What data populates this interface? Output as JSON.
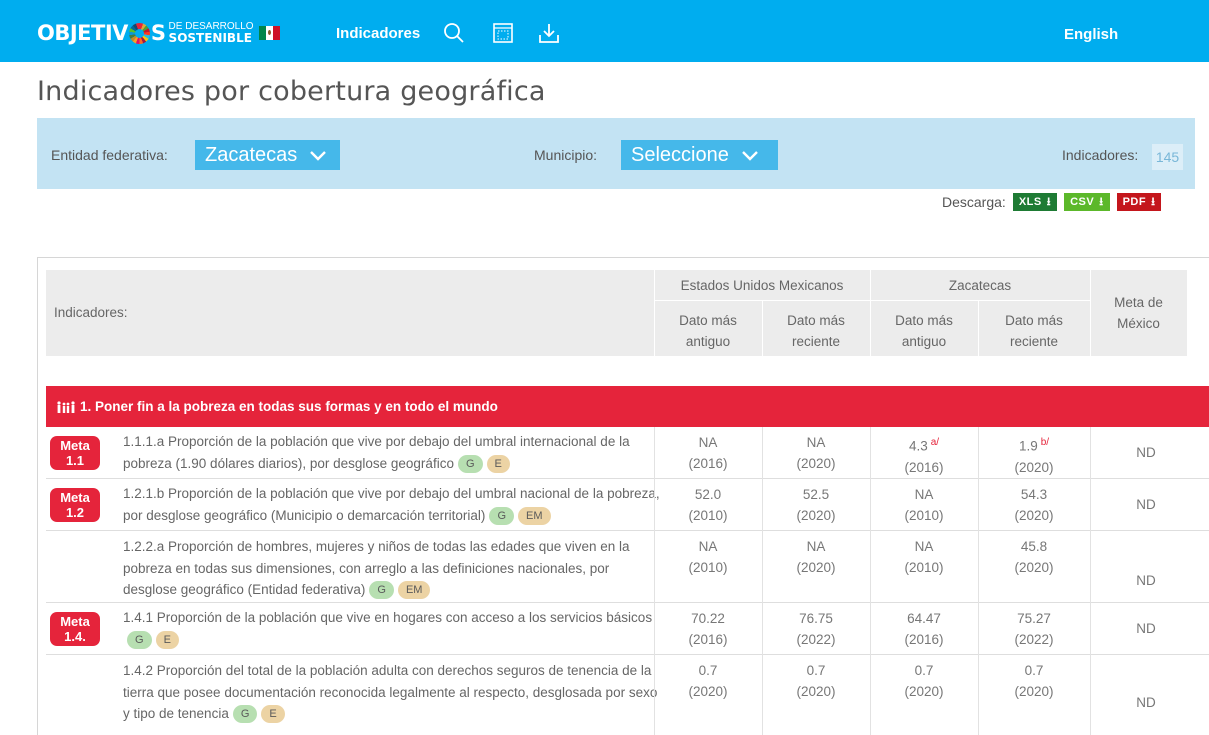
{
  "header": {
    "brand_main_a": "OBJETIV",
    "brand_main_b": "S",
    "brand_small_1": "DE DESARROLLO",
    "brand_small_2": "SOSTENIBLE",
    "nav_indicadores": "Indicadores",
    "lang_link": "English",
    "icons": [
      "search-icon",
      "calendar-icon",
      "download-icon"
    ]
  },
  "page": {
    "title": "Indicadores por cobertura geográfica"
  },
  "filters": {
    "entidad_label": "Entidad federativa:",
    "entidad_value": "Zacatecas",
    "municipio_label": "Municipio:",
    "municipio_value": "Seleccione",
    "count_label": "Indicadores:",
    "count_value": "145"
  },
  "downloads": {
    "label": "Descarga:",
    "buttons": [
      {
        "label": "XLS",
        "color": "#1e7b34"
      },
      {
        "label": "CSV",
        "color": "#5cb82a"
      },
      {
        "label": "PDF",
        "color": "#c4161c"
      }
    ]
  },
  "table": {
    "col_indicadores": "Indicadores:",
    "group_national": "Estados Unidos Mexicanos",
    "group_state": "Zacatecas",
    "sub_oldest_1": "Dato más",
    "sub_oldest_2": "antiguo",
    "sub_recent_1": "Dato más",
    "sub_recent_2": "reciente",
    "col_meta_1": "Meta de",
    "col_meta_2": "México",
    "goal": "1. Poner fin a la pobreza en todas sus formas y en todo el mundo",
    "rows": [
      {
        "meta_1": "Meta",
        "meta_2": "1.1",
        "text": "1.1.1.a Proporción de la población que vive por debajo del umbral internacional de la pobreza (1.90 dólares diarios), por desglose geográfico",
        "tags": [
          "G",
          "E"
        ],
        "nat_old_v": "NA",
        "nat_old_y": "(2016)",
        "nat_new_v": "NA",
        "nat_new_y": "(2020)",
        "st_old_v": "4.3",
        "st_old_note": "a/",
        "st_old_y": "(2016)",
        "st_new_v": "1.9",
        "st_new_note": "b/",
        "st_new_y": "(2020)",
        "meta_mx": "ND"
      },
      {
        "meta_1": "Meta",
        "meta_2": "1.2",
        "text": "1.2.1.b Proporción de la población que vive por debajo del umbral nacional de la pobreza, por desglose geográfico (Municipio o demarcación territorial)",
        "tags": [
          "G",
          "EM"
        ],
        "nat_old_v": "52.0",
        "nat_old_y": "(2010)",
        "nat_new_v": "52.5",
        "nat_new_y": "(2020)",
        "st_old_v": "NA",
        "st_old_y": "(2010)",
        "st_new_v": "54.3",
        "st_new_y": "(2020)",
        "meta_mx": "ND"
      },
      {
        "text": "1.2.2.a Proporción de hombres, mujeres y niños de todas las edades que viven en la pobreza en todas sus dimensiones, con arreglo a las definiciones nacionales, por desglose geográfico (Entidad federativa)",
        "tags": [
          "G",
          "EM"
        ],
        "nat_old_v": "NA",
        "nat_old_y": "(2010)",
        "nat_new_v": "NA",
        "nat_new_y": "(2020)",
        "st_old_v": "NA",
        "st_old_y": "(2010)",
        "st_new_v": "45.8",
        "st_new_y": "(2020)",
        "meta_mx": "ND"
      },
      {
        "meta_1": "Meta",
        "meta_2": "1.4.",
        "text": "1.4.1 Proporción de la población que vive en hogares con acceso a los servicios básicos",
        "tags": [
          "G",
          "E"
        ],
        "nat_old_v": "70.22",
        "nat_old_y": "(2016)",
        "nat_new_v": "76.75",
        "nat_new_y": "(2022)",
        "st_old_v": "64.47",
        "st_old_y": "(2016)",
        "st_new_v": "75.27",
        "st_new_y": "(2022)",
        "meta_mx": "ND"
      },
      {
        "text": "1.4.2 Proporción del total de la población adulta con derechos seguros de tenencia de la tierra que posee documentación reconocida legalmente al respecto, desglosada por sexo y tipo de tenencia",
        "tags": [
          "G",
          "E"
        ],
        "nat_old_v": "0.7",
        "nat_old_y": "(2020)",
        "nat_new_v": "0.7",
        "nat_new_y": "(2020)",
        "st_old_v": "0.7",
        "st_old_y": "(2020)",
        "st_new_v": "0.7",
        "st_new_y": "(2020)",
        "meta_mx": "ND"
      }
    ]
  }
}
